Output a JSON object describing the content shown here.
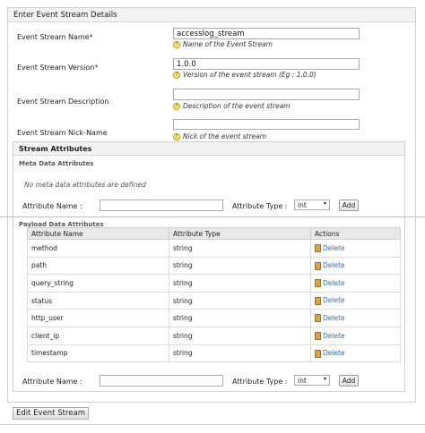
{
  "panel": {
    "title": "Enter Event Stream Details"
  },
  "form": {
    "name": {
      "label": "Event Stream Name",
      "required_mark": "*",
      "value": "accesslog_stream",
      "hint": "Name of the Event Stream"
    },
    "version": {
      "label": "Event Stream Version",
      "required_mark": "*",
      "value": "1.0.0",
      "hint": "Version of the event stream (Eg : 1.0.0)"
    },
    "description": {
      "label": "Event Stream Description",
      "value": "",
      "hint": "Description of the event stream"
    },
    "nickname": {
      "label": "Event Stream Nick-Name",
      "value": "",
      "hint": "Nick of the event stream"
    }
  },
  "stream_attributes": {
    "title": "Stream Attributes",
    "meta": {
      "title": "Meta Data Attributes",
      "empty_text": "No meta data attributes are defined",
      "name_label": "Attribute Name :",
      "type_label": "Attribute Type :",
      "type_value": "int",
      "add_label": "Add"
    },
    "payload": {
      "title": "Payload Data Attributes",
      "columns": [
        "Attribute Name",
        "Attribute Type",
        "Actions"
      ],
      "rows": [
        {
          "name": "method",
          "type": "string",
          "action": "Delete"
        },
        {
          "name": "path",
          "type": "string",
          "action": "Delete"
        },
        {
          "name": "query_string",
          "type": "string",
          "action": "Delete"
        },
        {
          "name": "status",
          "type": "string",
          "action": "Delete"
        },
        {
          "name": "http_user",
          "type": "string",
          "action": "Delete"
        },
        {
          "name": "client_ip",
          "type": "string",
          "action": "Delete"
        },
        {
          "name": "timestamp",
          "type": "string",
          "action": "Delete"
        }
      ],
      "name_label": "Attribute Name :",
      "type_label": "Attribute Type :",
      "type_value": "int",
      "add_label": "Add"
    }
  },
  "actions": {
    "edit_label": "Edit Event Stream"
  },
  "colors": {
    "link": "#2a6bd4",
    "required": "#cc0000",
    "header_bg": "#f2f2f2"
  }
}
